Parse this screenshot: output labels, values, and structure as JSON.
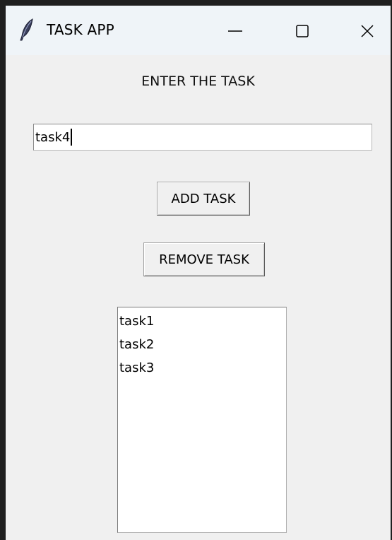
{
  "window": {
    "title": "TASK APP",
    "app_icon": "feather-icon",
    "controls": {
      "minimize_icon": "minimize-icon",
      "maximize_icon": "maximize-icon",
      "close_icon": "close-icon"
    }
  },
  "form": {
    "heading": "ENTER THE TASK",
    "task_input_value": "task4",
    "add_button_label": "ADD TASK",
    "remove_button_label": "REMOVE TASK"
  },
  "task_list": {
    "items": [
      "task1",
      "task2",
      "task3"
    ]
  },
  "colors": {
    "titlebar_bg": "#eff4f8",
    "window_bg": "#f0f0f0",
    "input_bg": "#ffffff"
  }
}
